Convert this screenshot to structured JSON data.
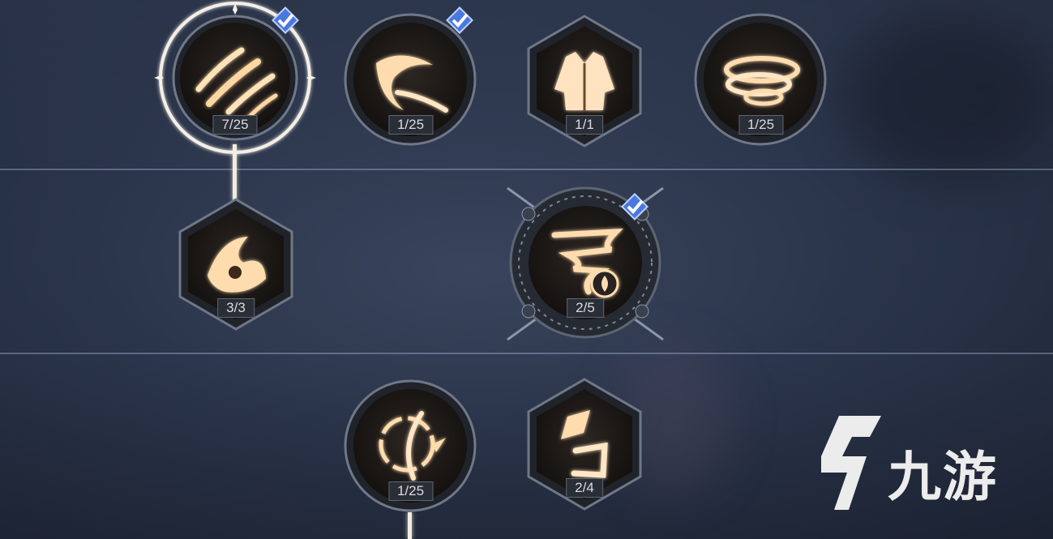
{
  "skill_tree": {
    "row1": [
      {
        "id": "claw-strike",
        "icon": "claw-slash-icon",
        "count": "7/25",
        "selected": true,
        "checked": true
      },
      {
        "id": "crescent-slash",
        "icon": "crescent-slash-icon",
        "count": "1/25",
        "checked": true
      },
      {
        "id": "armor",
        "icon": "jacket-armor-icon",
        "count": "1/1"
      },
      {
        "id": "whirl",
        "icon": "whirlwind-icon",
        "count": "1/25"
      }
    ],
    "row2": [
      {
        "id": "feather-burst",
        "icon": "feather-burst-icon",
        "count": "3/3"
      },
      {
        "id": "fire-tornado",
        "icon": "fire-tornado-icon",
        "count": "2/5",
        "checked": true
      }
    ],
    "row3": [
      {
        "id": "orbit-strike",
        "icon": "orbit-slash-icon",
        "count": "1/25"
      },
      {
        "id": "rune-shard",
        "icon": "rune-shard-icon",
        "count": "2/4"
      }
    ]
  },
  "watermark": {
    "text": "九游",
    "icon": "jiuyou-logo-icon"
  },
  "colors": {
    "glow": "#ffd9a8",
    "check": "#5b8cff",
    "frame": "#8a95a8"
  }
}
